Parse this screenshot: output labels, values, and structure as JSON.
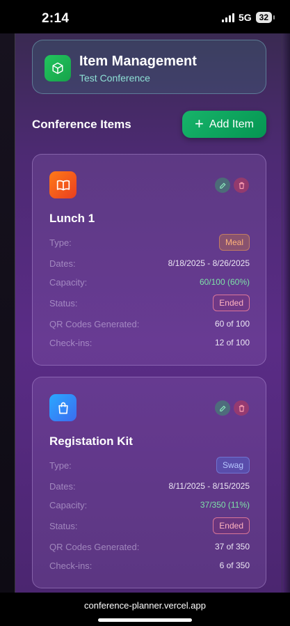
{
  "status_bar": {
    "time": "2:14",
    "network": "5G",
    "battery": "32"
  },
  "header": {
    "title": "Item Management",
    "subtitle": "Test Conference",
    "icon": "cube-icon"
  },
  "section": {
    "title": "Conference Items",
    "add_label": "Add Item"
  },
  "labels": {
    "type": "Type:",
    "dates": "Dates:",
    "capacity": "Capacity:",
    "status": "Status:",
    "qr": "QR Codes Generated:",
    "checkins": "Check-ins:"
  },
  "items": [
    {
      "name": "Lunch 1",
      "icon": "book-open-icon",
      "type": "Meal",
      "dates": "8/18/2025 - 8/26/2025",
      "capacity": "60/100 (60%)",
      "status": "Ended",
      "qr": "60 of 100",
      "checkins": "12 of 100"
    },
    {
      "name": "Registation Kit",
      "icon": "shopping-bag-icon",
      "type": "Swag",
      "dates": "8/11/2025 - 8/15/2025",
      "capacity": "37/350 (11%)",
      "status": "Ended",
      "qr": "37 of 350",
      "checkins": "6 of 350"
    }
  ],
  "browser": {
    "url": "conference-planner.vercel.app"
  },
  "colors": {
    "accent_green": "#16a34a",
    "meal_orange": "#f97316",
    "swag_blue": "#3b82f6",
    "ended_pink": "#fda4af"
  }
}
